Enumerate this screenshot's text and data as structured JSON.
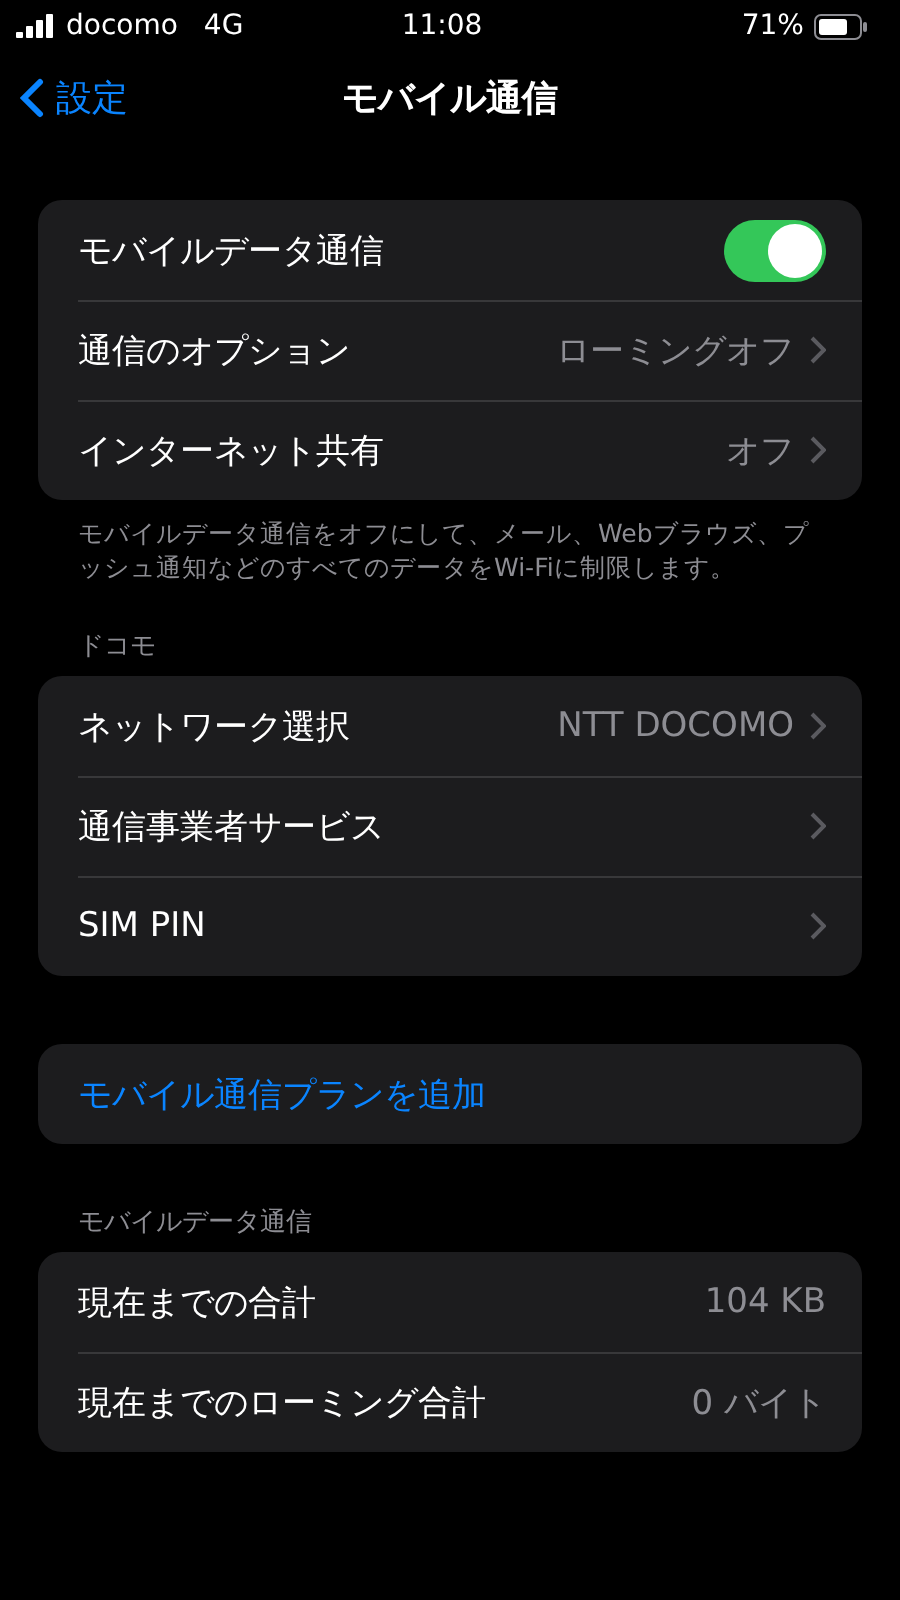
{
  "status_bar": {
    "carrier": "docomo",
    "network": "4G",
    "time": "11:08",
    "battery": "71%"
  },
  "nav": {
    "back": "設定",
    "title": "モバイル通信"
  },
  "sections": [
    {
      "rows": [
        {
          "kind": "toggle",
          "label": "モバイルデータ通信",
          "on": true
        },
        {
          "kind": "link",
          "label": "通信のオプション",
          "value": "ローミングオフ"
        },
        {
          "kind": "link",
          "label": "インターネット共有",
          "value": "オフ"
        }
      ],
      "footer": "モバイルデータ通信をオフにして、メール、Webブラウズ、プッシュ通知などのすべてのデータをWi-Fiに制限します。"
    },
    {
      "header": "ドコモ",
      "rows": [
        {
          "kind": "link",
          "label": "ネットワーク選択",
          "value": "NTT DOCOMO"
        },
        {
          "kind": "link",
          "label": "通信事業者サービス"
        },
        {
          "kind": "link",
          "label": "SIM PIN"
        }
      ]
    },
    {
      "rows": [
        {
          "kind": "action",
          "label": "モバイル通信プランを追加"
        }
      ]
    },
    {
      "header": "モバイルデータ通信",
      "rows": [
        {
          "kind": "info",
          "label": "現在までの合計",
          "value": "104 KB"
        },
        {
          "kind": "info",
          "label": "現在までのローミング合計",
          "value": "0 バイト"
        }
      ]
    }
  ]
}
